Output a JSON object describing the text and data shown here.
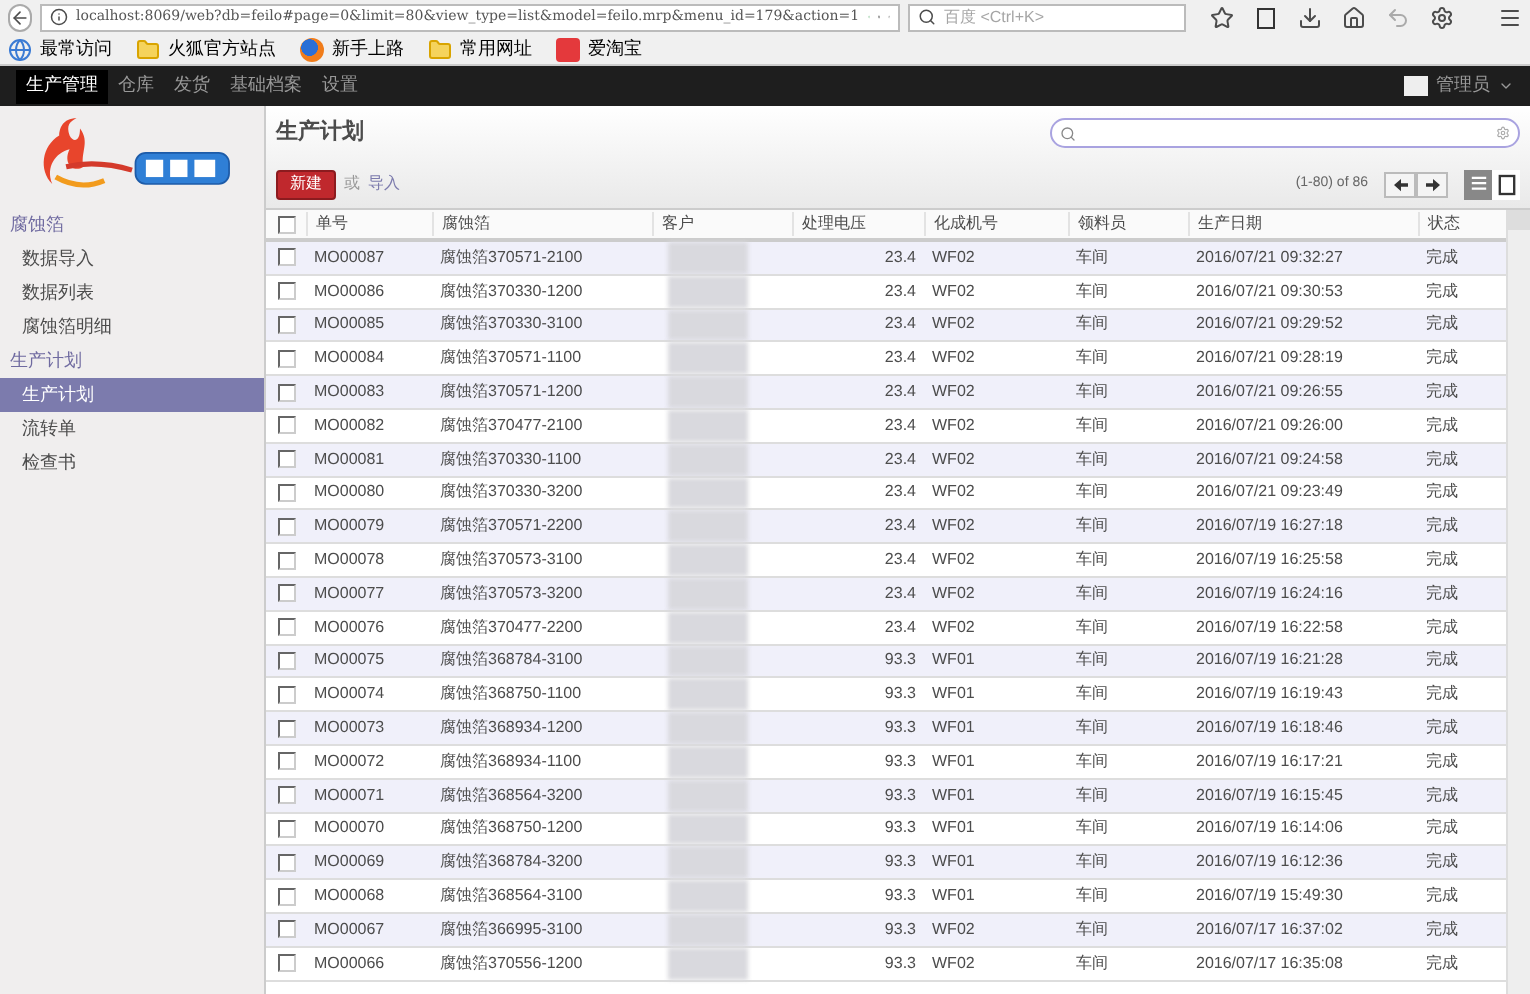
{
  "browser": {
    "url": "localhost:8069/web?db=feilo#page=0&limit=80&view_type=list&model=feilo.mrp&menu_id=179&action=1",
    "search_placeholder": "百度 <Ctrl+K>",
    "bookmarks": [
      {
        "label": "最常访问",
        "kind": "globe"
      },
      {
        "label": "火狐官方站点",
        "kind": "folder"
      },
      {
        "label": "新手上路",
        "kind": "firefox"
      },
      {
        "label": "常用网址",
        "kind": "folder"
      },
      {
        "label": "爱淘宝",
        "kind": "taobao"
      }
    ]
  },
  "top_menu": [
    {
      "label": "生产管理",
      "selected": true
    },
    {
      "label": "仓库",
      "selected": false
    },
    {
      "label": "发货",
      "selected": false
    },
    {
      "label": "基础档案",
      "selected": false
    },
    {
      "label": "设置",
      "selected": false
    }
  ],
  "user": "管理员",
  "sidebar": [
    {
      "title": "腐蚀箔",
      "items": [
        {
          "label": "数据导入",
          "selected": false
        },
        {
          "label": "数据列表",
          "selected": false
        },
        {
          "label": "腐蚀箔明细",
          "selected": false
        }
      ]
    },
    {
      "title": "生产计划",
      "items": [
        {
          "label": "生产计划",
          "selected": true
        },
        {
          "label": "流转单",
          "selected": false
        },
        {
          "label": "检查书",
          "selected": false
        }
      ]
    }
  ],
  "page_title": "生产计划",
  "create_button": "新建",
  "or_text": "或",
  "import_link": "导入",
  "pager": "(1-80) of 86",
  "view_modes": [
    {
      "kind": "list",
      "selected": true
    },
    {
      "kind": "form",
      "selected": false
    }
  ],
  "table": {
    "select_all_checked": false,
    "columns": [
      "单号",
      "腐蚀箔",
      "客户",
      "处理电压",
      "化成机号",
      "领料员",
      "生产日期",
      "状态"
    ],
    "rows": [
      {
        "checked": false,
        "cells": [
          "MO00087",
          "腐蚀箔370571-2100",
          "",
          "23.4",
          "WF02",
          "车间",
          "2016/07/21 09:32:27",
          "完成"
        ]
      },
      {
        "checked": false,
        "cells": [
          "MO00086",
          "腐蚀箔370330-1200",
          "",
          "23.4",
          "WF02",
          "车间",
          "2016/07/21 09:30:53",
          "完成"
        ]
      },
      {
        "checked": false,
        "cells": [
          "MO00085",
          "腐蚀箔370330-3100",
          "",
          "23.4",
          "WF02",
          "车间",
          "2016/07/21 09:29:52",
          "完成"
        ]
      },
      {
        "checked": false,
        "cells": [
          "MO00084",
          "腐蚀箔370571-1100",
          "",
          "23.4",
          "WF02",
          "车间",
          "2016/07/21 09:28:19",
          "完成"
        ]
      },
      {
        "checked": false,
        "cells": [
          "MO00083",
          "腐蚀箔370571-1200",
          "",
          "23.4",
          "WF02",
          "车间",
          "2016/07/21 09:26:55",
          "完成"
        ]
      },
      {
        "checked": false,
        "cells": [
          "MO00082",
          "腐蚀箔370477-2100",
          "",
          "23.4",
          "WF02",
          "车间",
          "2016/07/21 09:26:00",
          "完成"
        ]
      },
      {
        "checked": false,
        "cells": [
          "MO00081",
          "腐蚀箔370330-1100",
          "",
          "23.4",
          "WF02",
          "车间",
          "2016/07/21 09:24:58",
          "完成"
        ]
      },
      {
        "checked": false,
        "cells": [
          "MO00080",
          "腐蚀箔370330-3200",
          "",
          "23.4",
          "WF02",
          "车间",
          "2016/07/21 09:23:49",
          "完成"
        ]
      },
      {
        "checked": false,
        "cells": [
          "MO00079",
          "腐蚀箔370571-2200",
          "",
          "23.4",
          "WF02",
          "车间",
          "2016/07/19 16:27:18",
          "完成"
        ]
      },
      {
        "checked": false,
        "cells": [
          "MO00078",
          "腐蚀箔370573-3100",
          "",
          "23.4",
          "WF02",
          "车间",
          "2016/07/19 16:25:58",
          "完成"
        ]
      },
      {
        "checked": false,
        "cells": [
          "MO00077",
          "腐蚀箔370573-3200",
          "",
          "23.4",
          "WF02",
          "车间",
          "2016/07/19 16:24:16",
          "完成"
        ]
      },
      {
        "checked": false,
        "cells": [
          "MO00076",
          "腐蚀箔370477-2200",
          "",
          "23.4",
          "WF02",
          "车间",
          "2016/07/19 16:22:58",
          "完成"
        ]
      },
      {
        "checked": false,
        "cells": [
          "MO00075",
          "腐蚀箔368784-3100",
          "",
          "93.3",
          "WF01",
          "车间",
          "2016/07/19 16:21:28",
          "完成"
        ]
      },
      {
        "checked": false,
        "cells": [
          "MO00074",
          "腐蚀箔368750-1100",
          "",
          "93.3",
          "WF01",
          "车间",
          "2016/07/19 16:19:43",
          "完成"
        ]
      },
      {
        "checked": false,
        "cells": [
          "MO00073",
          "腐蚀箔368934-1200",
          "",
          "93.3",
          "WF01",
          "车间",
          "2016/07/19 16:18:46",
          "完成"
        ]
      },
      {
        "checked": false,
        "cells": [
          "MO00072",
          "腐蚀箔368934-1100",
          "",
          "93.3",
          "WF01",
          "车间",
          "2016/07/19 16:17:21",
          "完成"
        ]
      },
      {
        "checked": false,
        "cells": [
          "MO00071",
          "腐蚀箔368564-3200",
          "",
          "93.3",
          "WF01",
          "车间",
          "2016/07/19 16:15:45",
          "完成"
        ]
      },
      {
        "checked": false,
        "cells": [
          "MO00070",
          "腐蚀箔368750-1200",
          "",
          "93.3",
          "WF01",
          "车间",
          "2016/07/19 16:14:06",
          "完成"
        ]
      },
      {
        "checked": false,
        "cells": [
          "MO00069",
          "腐蚀箔368784-3200",
          "",
          "93.3",
          "WF01",
          "车间",
          "2016/07/19 16:12:36",
          "完成"
        ]
      },
      {
        "checked": false,
        "cells": [
          "MO00068",
          "腐蚀箔368564-3100",
          "",
          "93.3",
          "WF01",
          "车间",
          "2016/07/19 15:49:30",
          "完成"
        ]
      },
      {
        "checked": false,
        "cells": [
          "MO00067",
          "腐蚀箔366995-3100",
          "",
          "93.3",
          "WF02",
          "车间",
          "2016/07/17 16:37:02",
          "完成"
        ]
      },
      {
        "checked": false,
        "cells": [
          "MO00066",
          "腐蚀箔370556-1200",
          "",
          "93.3",
          "WF02",
          "车间",
          "2016/07/17 16:35:08",
          "完成"
        ]
      }
    ]
  }
}
